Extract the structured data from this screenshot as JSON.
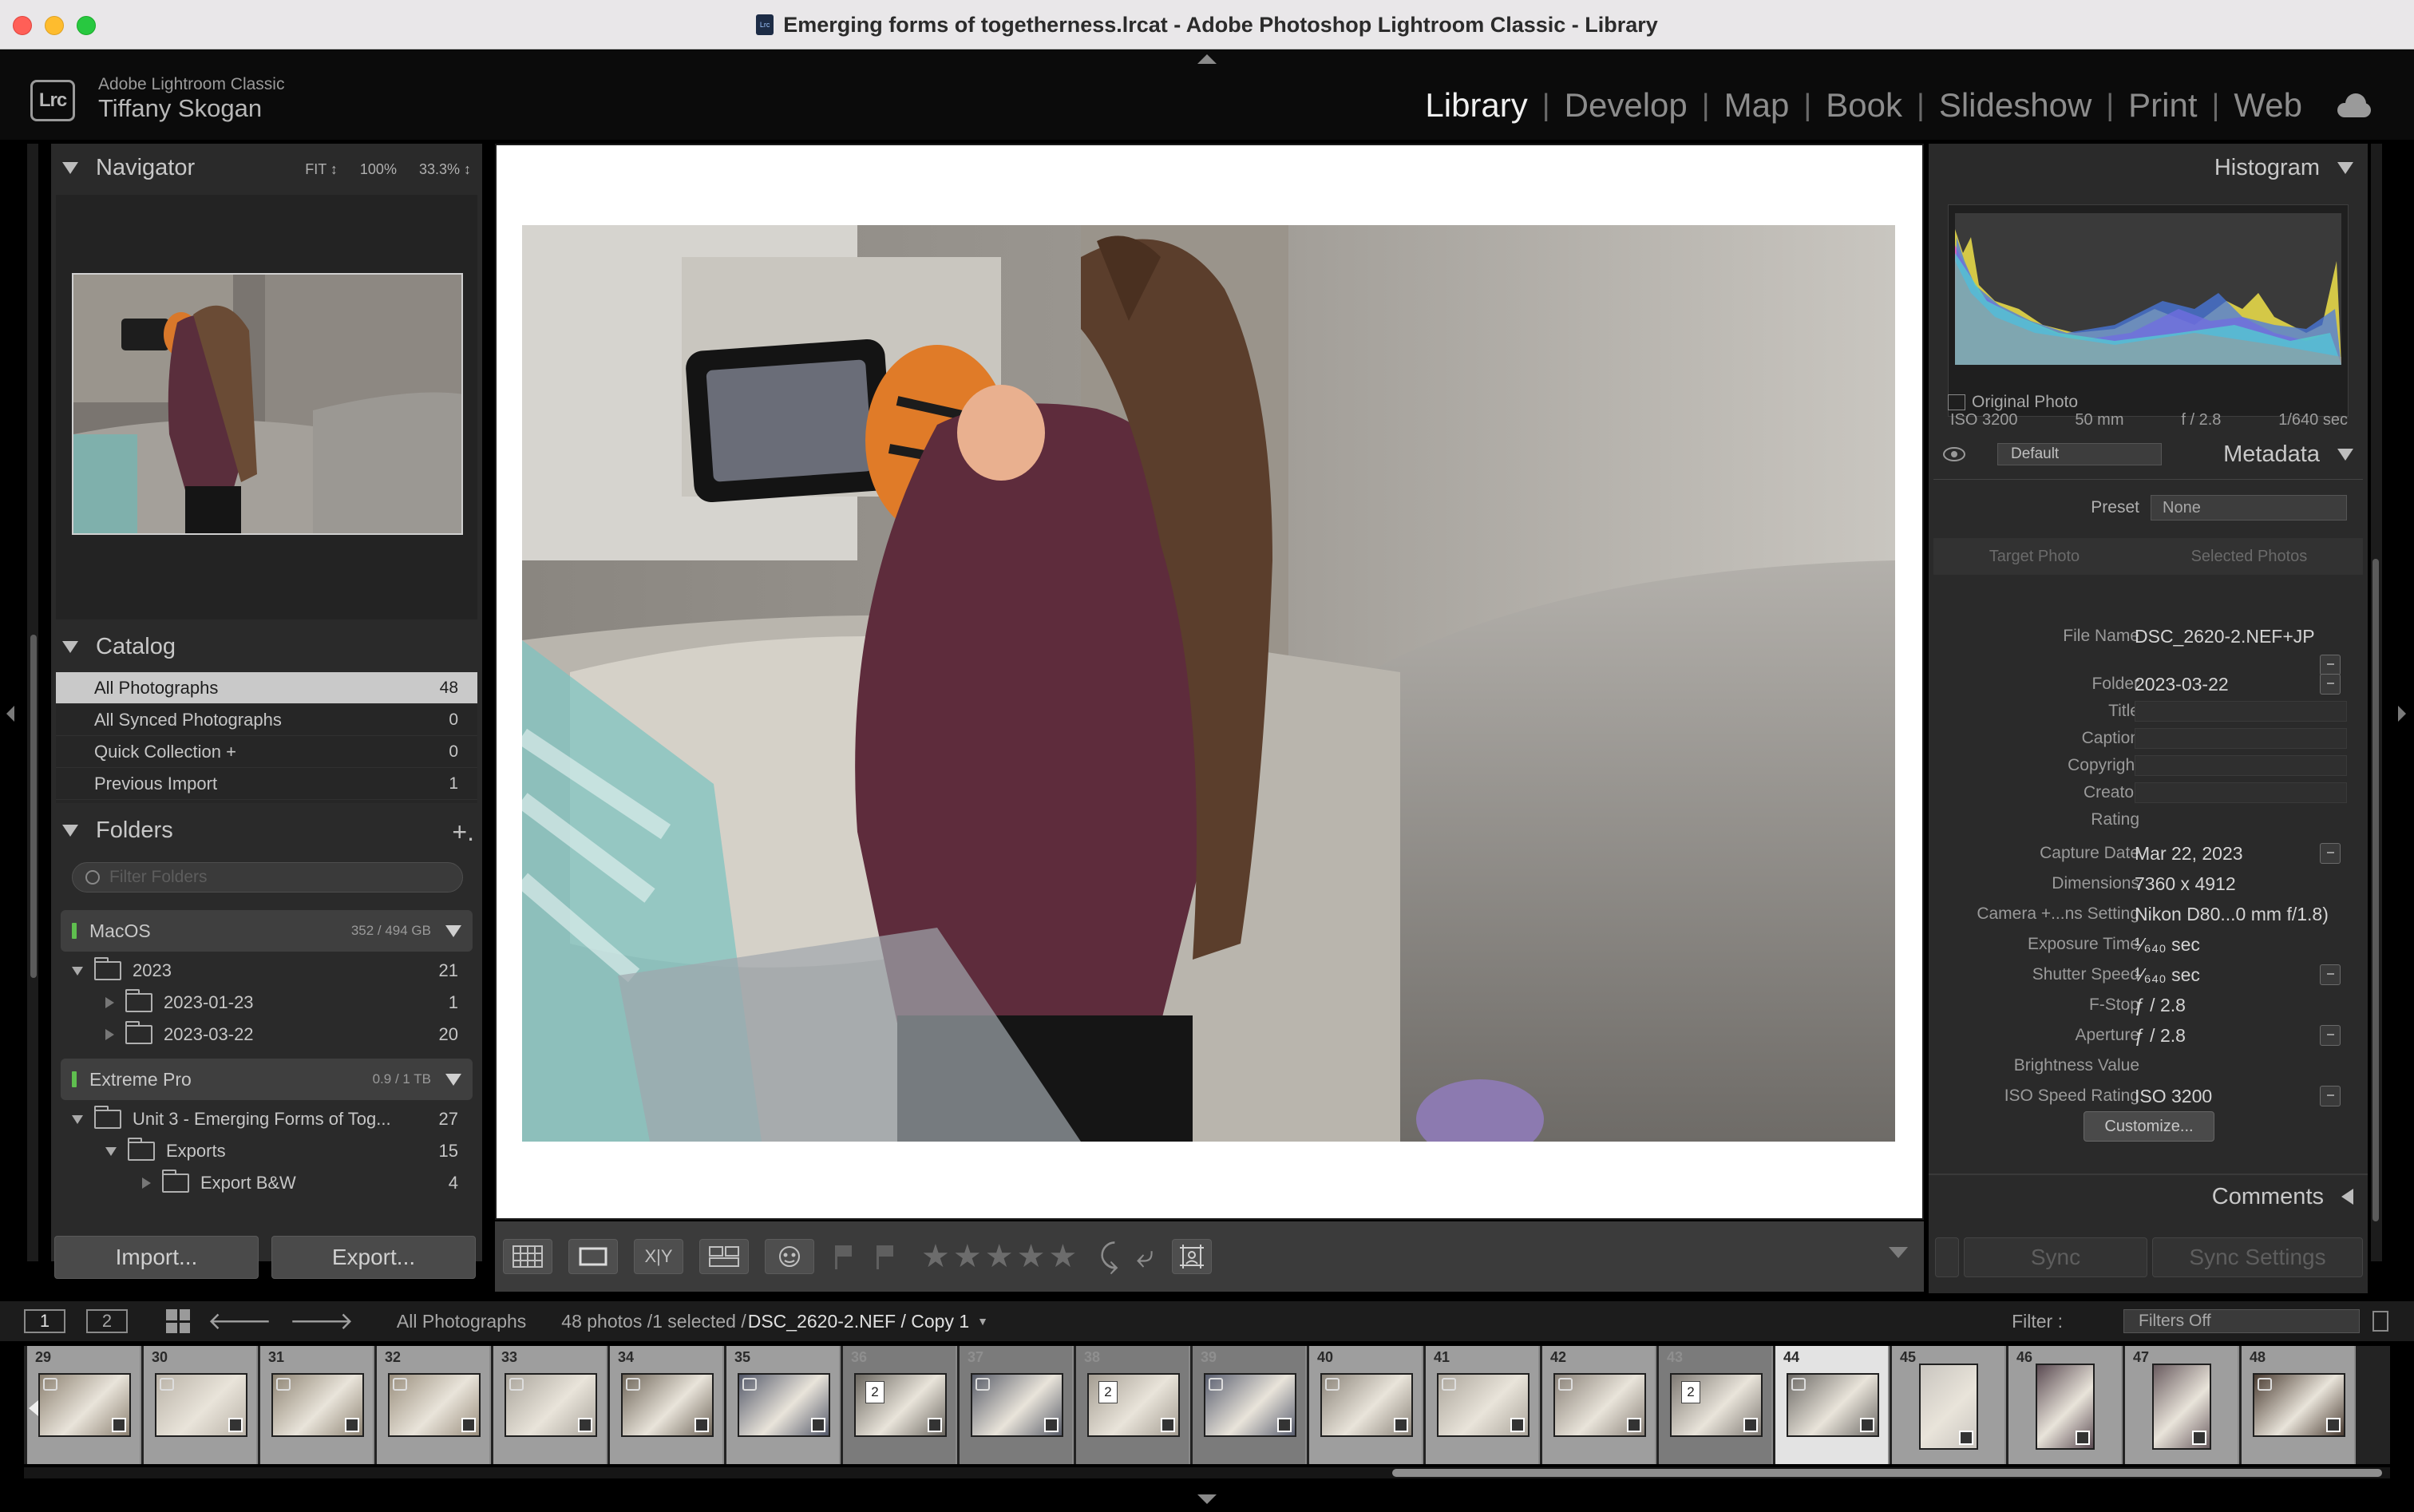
{
  "window": {
    "title": "Emerging forms of togetherness.lrcat - Adobe Photoshop Lightroom Classic - Library",
    "icon_text": "Lrc"
  },
  "identity": {
    "logo": "Lrc",
    "app_name": "Adobe Lightroom Classic",
    "user_name": "Tiffany Skogan"
  },
  "modules": [
    "Library",
    "Develop",
    "Map",
    "Book",
    "Slideshow",
    "Print",
    "Web"
  ],
  "navigator": {
    "title": "Navigator",
    "zoom_options": [
      "FIT ↕",
      "100%",
      "33.3% ↕"
    ]
  },
  "catalog": {
    "title": "Catalog",
    "items": [
      {
        "label": "All Photographs",
        "count": "48"
      },
      {
        "label": "All Synced Photographs",
        "count": "0"
      },
      {
        "label": "Quick Collection  +",
        "count": "0"
      },
      {
        "label": "Previous Import",
        "count": "1"
      }
    ]
  },
  "folders": {
    "title": "Folders",
    "add": "+.",
    "filter_placeholder": "Filter Folders",
    "volumes": [
      {
        "name": "MacOS",
        "space": "352 / 494 GB"
      },
      {
        "name": "Extreme Pro",
        "space": "0.9 / 1 TB"
      }
    ],
    "tree": [
      {
        "label": "2023",
        "count": "21"
      },
      {
        "label": "2023-01-23",
        "count": "1"
      },
      {
        "label": "2023-03-22",
        "count": "20"
      },
      {
        "label": "Unit 3 - Emerging Forms of Tog...",
        "count": "27"
      },
      {
        "label": "Exports",
        "count": "15"
      },
      {
        "label": "Export B&W",
        "count": "4"
      }
    ]
  },
  "left_buttons": {
    "import": "Import...",
    "export": "Export..."
  },
  "toolbar": {
    "stars": "★★★★★",
    "view_icons": [
      "grid-view",
      "loupe-view",
      "compare-view",
      "survey-view",
      "people-view"
    ],
    "compare_label": "X|Y"
  },
  "histogram": {
    "title": "Histogram",
    "iso": "ISO 3200",
    "focal": "50 mm",
    "aperture": "f / 2.8",
    "shutter": "1/640 sec",
    "original_photo": "Original Photo"
  },
  "metadata": {
    "title": "Metadata",
    "preset_set": "Default",
    "preset_label": "Preset",
    "preset_value": "None",
    "target_photo": "Target Photo",
    "selected_photos": "Selected Photos",
    "fields": [
      {
        "label": "File Name",
        "value": "DSC_2620-2.NEF+JP"
      },
      {
        "label": "Folder",
        "value": "2023-03-22"
      },
      {
        "label": "Title",
        "value": ""
      },
      {
        "label": "Caption",
        "value": ""
      },
      {
        "label": "Copyright",
        "value": ""
      },
      {
        "label": "Creator",
        "value": ""
      },
      {
        "label": "Rating",
        "value": ""
      },
      {
        "label": "Capture Date",
        "value": "Mar 22, 2023"
      },
      {
        "label": "Dimensions",
        "value": "7360 x 4912"
      },
      {
        "label": "Camera +...ns Setting",
        "value": "Nikon D80...0 mm f/1.8)"
      },
      {
        "label": "Exposure Time",
        "value": "¹⁄₆₄₀ sec"
      },
      {
        "label": "Shutter Speed",
        "value": "¹⁄₆₄₀ sec"
      },
      {
        "label": "F-Stop",
        "value": "ƒ / 2.8"
      },
      {
        "label": "Aperture",
        "value": "ƒ / 2.8"
      },
      {
        "label": "Brightness Value",
        "value": ""
      },
      {
        "label": "ISO Speed Rating",
        "value": "ISO 3200"
      }
    ],
    "customize": "Customize..."
  },
  "comments": {
    "title": "Comments"
  },
  "sync": {
    "sync": "Sync",
    "sync_settings": "Sync Settings"
  },
  "filmstrip_bar": {
    "window1": "1",
    "window2": "2",
    "source": "All Photographs",
    "info": "48 photos /1 selected /",
    "file": "DSC_2620-2.NEF / Copy 1",
    "filter_label": "Filter :",
    "filter_value": "Filters Off"
  },
  "filmstrip": [
    {
      "num": "29",
      "tone": "#8c8172"
    },
    {
      "num": "30",
      "tone": "#b9b2a7"
    },
    {
      "num": "31",
      "tone": "#8e8474"
    },
    {
      "num": "32",
      "tone": "#9a8f7e"
    },
    {
      "num": "33",
      "tone": "#aaa59c"
    },
    {
      "num": "34",
      "tone": "#6f665a"
    },
    {
      "num": "35",
      "tone": "#54596a"
    },
    {
      "num": "36",
      "tone": "#6b6760",
      "stack": "2"
    },
    {
      "num": "37",
      "tone": "#585c68"
    },
    {
      "num": "38",
      "tone": "#a49d92",
      "stack": "2"
    },
    {
      "num": "39",
      "tone": "#5a5f70"
    },
    {
      "num": "40",
      "tone": "#8b847a"
    },
    {
      "num": "41",
      "tone": "#aba59b"
    },
    {
      "num": "42",
      "tone": "#8a8279"
    },
    {
      "num": "43",
      "tone": "#7f7a74",
      "stack": "2"
    },
    {
      "num": "44",
      "tone": "#6d6a66"
    },
    {
      "num": "45",
      "tone": "#c9c5bf"
    },
    {
      "num": "46",
      "tone": "#5a4a52"
    },
    {
      "num": "47",
      "tone": "#6a5c60"
    },
    {
      "num": "48",
      "tone": "#4a3c32"
    }
  ]
}
